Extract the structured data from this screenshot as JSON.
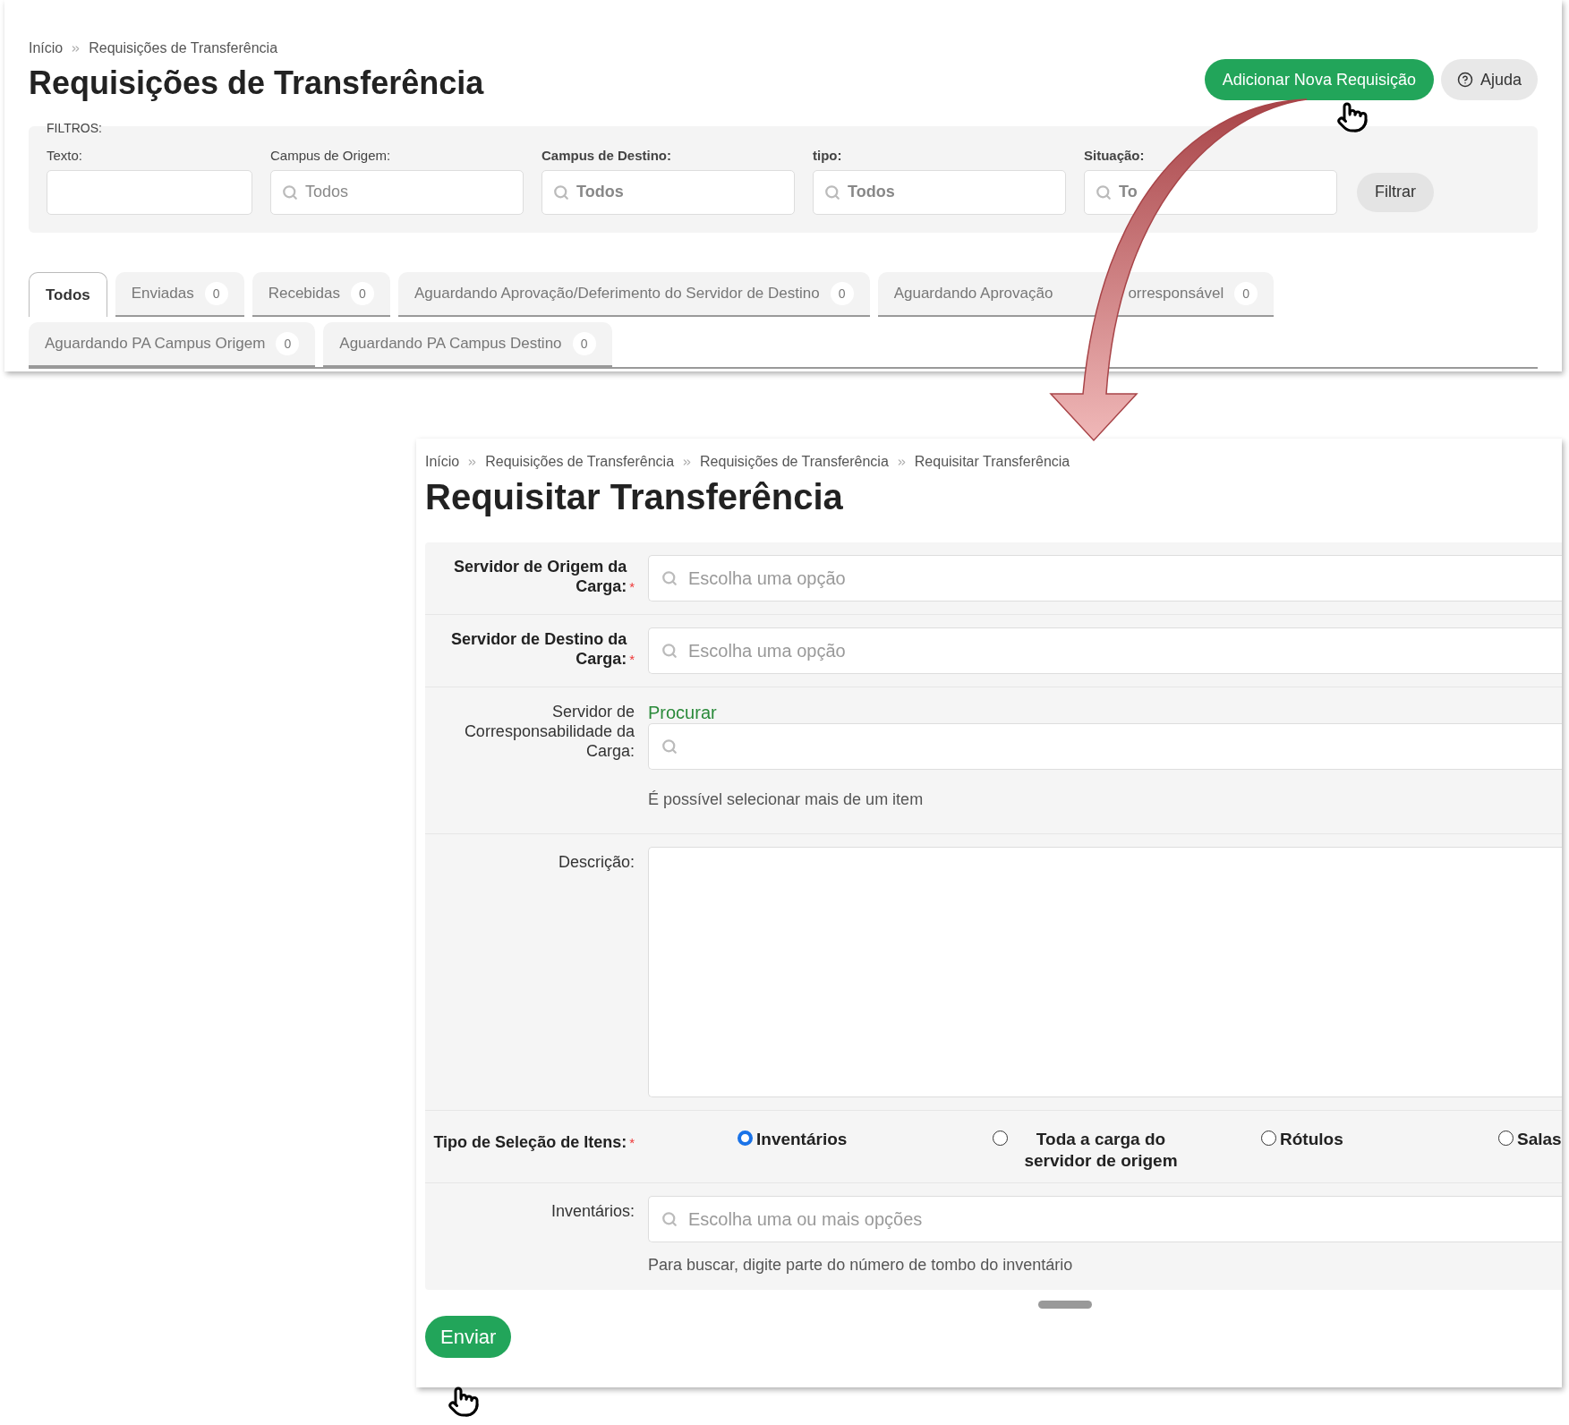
{
  "list_page": {
    "breadcrumb": [
      "Início",
      "Requisições de Transferência"
    ],
    "title": "Requisições de Transferência",
    "add_button": "Adicionar Nova Requisição",
    "help_button": "Ajuda",
    "filters": {
      "legend": "FILTROS:",
      "submit": "Filtrar",
      "fields": [
        {
          "label": "Texto:",
          "kind": "text",
          "bold": false
        },
        {
          "label": "Campus de Origem:",
          "kind": "select",
          "value": "Todos",
          "bold": false
        },
        {
          "label": "Campus de Destino:",
          "kind": "select",
          "value": "Todos",
          "bold": true
        },
        {
          "label": "tipo:",
          "kind": "select",
          "value": "Todos",
          "bold": true
        },
        {
          "label": "Situação:",
          "kind": "select",
          "value": "To",
          "bold": true
        }
      ]
    },
    "tabs": [
      {
        "label": "Todos",
        "selected": true
      },
      {
        "label": "Enviadas",
        "count": "0",
        "selected": false
      },
      {
        "label": "Recebidas",
        "count": "0",
        "selected": false
      },
      {
        "label": "Aguardando Aprovação/Deferimento do Servidor de Destino",
        "count": "0",
        "selected": false
      },
      {
        "label": "Aguardando Aprovação",
        "label_after": "orresponsável",
        "count": "0",
        "selected": false
      },
      {
        "label": "Aguardando PA Campus Origem",
        "count": "0",
        "selected": false
      },
      {
        "label": "Aguardando PA Campus Destino",
        "count": "0",
        "selected": false
      }
    ]
  },
  "form_page": {
    "breadcrumb": [
      "Início",
      "Requisições de Transferência",
      "Requisições de Transferência",
      "Requisitar Transferência"
    ],
    "title": "Requisitar Transferência",
    "rows": [
      {
        "kind": "select",
        "label": "Servidor de Origem da Carga:",
        "bold": true,
        "required_mark": "*",
        "placeholder": "Escolha uma opção"
      },
      {
        "kind": "select",
        "label": "Servidor de Destino da Carga:",
        "bold": true,
        "required_mark": "*",
        "placeholder": "Escolha uma opção"
      },
      {
        "kind": "search",
        "label": "Servidor de Corresponsabilidade da Carga:",
        "bold": false,
        "link": "Procurar",
        "help": "É possível selecionar mais de um item"
      },
      {
        "kind": "textarea",
        "label": "Descrição:",
        "bold": false
      },
      {
        "kind": "radio",
        "label": "Tipo de Seleção de Itens:",
        "bold": true,
        "required_mark": "*",
        "options": [
          {
            "label": "Inventários",
            "selected": true
          },
          {
            "label": "Toda a carga do servidor de origem",
            "selected": false
          },
          {
            "label": "Rótulos",
            "selected": false
          },
          {
            "label": "Salas",
            "selected": false
          }
        ]
      },
      {
        "kind": "select",
        "label": "Inventários:",
        "bold": false,
        "placeholder": "Escolha uma ou mais opções",
        "help": "Para buscar, digite parte do número de tombo do inventário"
      }
    ],
    "submit": "Enviar"
  }
}
